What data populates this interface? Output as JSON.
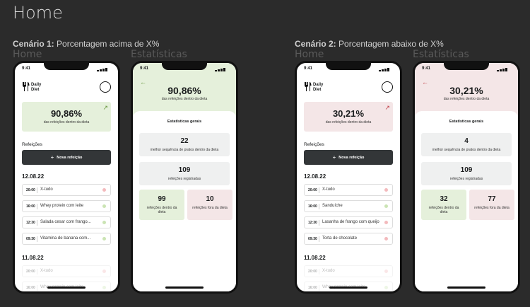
{
  "page_title": "Home",
  "colors": {
    "green_light": "#e5f0db",
    "red_light": "#f4e6e7",
    "green_dot": "#cbe4b4",
    "red_dot": "#f3babd",
    "green_dark": "#639339",
    "red_dark": "#bf3b44",
    "button_dark": "#333638"
  },
  "scenario1": {
    "heading_bold": "Cenário 1:",
    "heading_rest": "Porcentagem acima de X%",
    "home_label": "Home",
    "stats_label": "Estatísticas",
    "home": {
      "time": "9:41",
      "logo_line1": "Daily",
      "logo_line2": "Diet",
      "percent": "90,86%",
      "percent_sub": "das refeições dentro da dieta",
      "arrow_icon": "↗",
      "meals_label": "Refeições",
      "new_meal_label": "Nova refeição",
      "plus_icon": "+",
      "groups": [
        {
          "date": "12.08.22",
          "meals": [
            {
              "time": "20:00",
              "name": "X-tudo",
              "in_diet": false
            },
            {
              "time": "16:00",
              "name": "Whey protein com leite",
              "in_diet": true
            },
            {
              "time": "12:30",
              "name": "Salada cesar com frango...",
              "in_diet": true
            },
            {
              "time": "09:30",
              "name": "Vitamina de banana com...",
              "in_diet": true
            }
          ]
        },
        {
          "date": "11.08.22",
          "meals": [
            {
              "time": "20:00",
              "name": "X-tudo",
              "in_diet": false
            },
            {
              "time": "16:00",
              "name": "Whey protein com leite",
              "in_diet": true
            }
          ]
        }
      ]
    },
    "stats": {
      "time": "9:41",
      "back_icon": "←",
      "percent": "90,86%",
      "percent_sub": "das refeições dentro da dieta",
      "general_title": "Estatísticas gerais",
      "best_seq_value": "22",
      "best_seq_label": "melhor sequência de pratos dentro da dieta",
      "registered_value": "109",
      "registered_label": "refeições registradas",
      "in_diet_value": "99",
      "in_diet_label": "refeições dentro da dieta",
      "out_diet_value": "10",
      "out_diet_label": "refeições fora da dieta"
    }
  },
  "scenario2": {
    "heading_bold": "Cenário 2:",
    "heading_rest": "Porcentagem abaixo de X%",
    "home_label": "Home",
    "stats_label": "Estatísticas",
    "home": {
      "time": "9:41",
      "logo_line1": "Daily",
      "logo_line2": "Diet",
      "percent": "30,21%",
      "percent_sub": "das refeições dentro da dieta",
      "arrow_icon": "↗",
      "meals_label": "Refeições",
      "new_meal_label": "Nova refeição",
      "plus_icon": "+",
      "groups": [
        {
          "date": "12.08.22",
          "meals": [
            {
              "time": "20:00",
              "name": "X-tudo",
              "in_diet": false
            },
            {
              "time": "16:00",
              "name": "Sanduíche",
              "in_diet": true
            },
            {
              "time": "12:30",
              "name": "Lasanha de frango com queijo",
              "in_diet": false
            },
            {
              "time": "09:30",
              "name": "Torta de chocolate",
              "in_diet": false
            }
          ]
        },
        {
          "date": "11.08.22",
          "meals": [
            {
              "time": "20:00",
              "name": "X-tudo",
              "in_diet": false
            },
            {
              "time": "16:00",
              "name": "Whey protein com leite",
              "in_diet": true
            }
          ]
        }
      ]
    },
    "stats": {
      "time": "9:41",
      "back_icon": "←",
      "percent": "30,21%",
      "percent_sub": "das refeições dentro da dieta",
      "general_title": "Estatísticas gerais",
      "best_seq_value": "4",
      "best_seq_label": "melhor sequência de pratos dentro da dieta",
      "registered_value": "109",
      "registered_label": "refeições registradas",
      "in_diet_value": "32",
      "in_diet_label": "refeições dentro da dieta",
      "out_diet_value": "77",
      "out_diet_label": "refeições fora da dieta"
    }
  }
}
